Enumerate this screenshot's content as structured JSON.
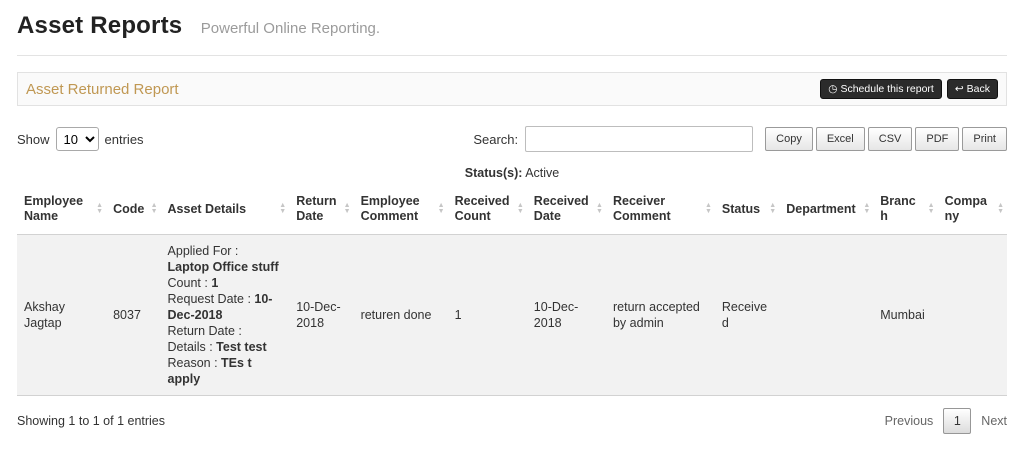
{
  "header": {
    "title": "Asset Reports",
    "subtitle": "Powerful Online Reporting."
  },
  "panel": {
    "title": "Asset Returned Report",
    "schedule_button_label": "Schedule this report",
    "back_button_label": "Back"
  },
  "controls": {
    "show_label": "Show",
    "page_size": "10",
    "entries_label": "entries",
    "search_label": "Search:",
    "search_value": "",
    "export_buttons": [
      "Copy",
      "Excel",
      "CSV",
      "PDF",
      "Print"
    ]
  },
  "status_line": {
    "label": "Status(s):",
    "value": "Active"
  },
  "table": {
    "columns": [
      "Employee Name",
      "Code",
      "Asset Details",
      "Return Date",
      "Employee Comment",
      "Received Count",
      "Received Date",
      "Receiver Comment",
      "Status",
      "Department",
      "Branch",
      "Company"
    ],
    "row": {
      "employee_name": "Akshay Jagtap",
      "code": "8037",
      "asset_details": [
        {
          "label": "Applied For :",
          "value": "Laptop Office stuff"
        },
        {
          "label": "Count :",
          "value": "1"
        },
        {
          "label": "Request Date :",
          "value": "10-Dec-2018"
        },
        {
          "label": "Return Date :",
          "value": ""
        },
        {
          "label": "Details :",
          "value": "Test test"
        },
        {
          "label": "Reason :",
          "value": "TEs t apply"
        }
      ],
      "return_date": "10-Dec-2018",
      "employee_comment": "returen done",
      "received_count": "1",
      "received_date": "10-Dec-2018",
      "receiver_comment": "return accepted by admin",
      "status": "Received",
      "department": "",
      "branch": "Mumbai",
      "company": ""
    }
  },
  "footer": {
    "showing_text": "Showing 1 to 1 of 1 entries",
    "previous_label": "Previous",
    "page_number": "1",
    "next_label": "Next"
  },
  "icons": {
    "schedule": "◷",
    "back": "↩",
    "sort_asc": "▲",
    "sort_desc": "▼"
  },
  "colors": {
    "panel_title": "#c09853",
    "dark_button_bg": "#2b2b2b",
    "row_bg": "#f2f2f2"
  }
}
